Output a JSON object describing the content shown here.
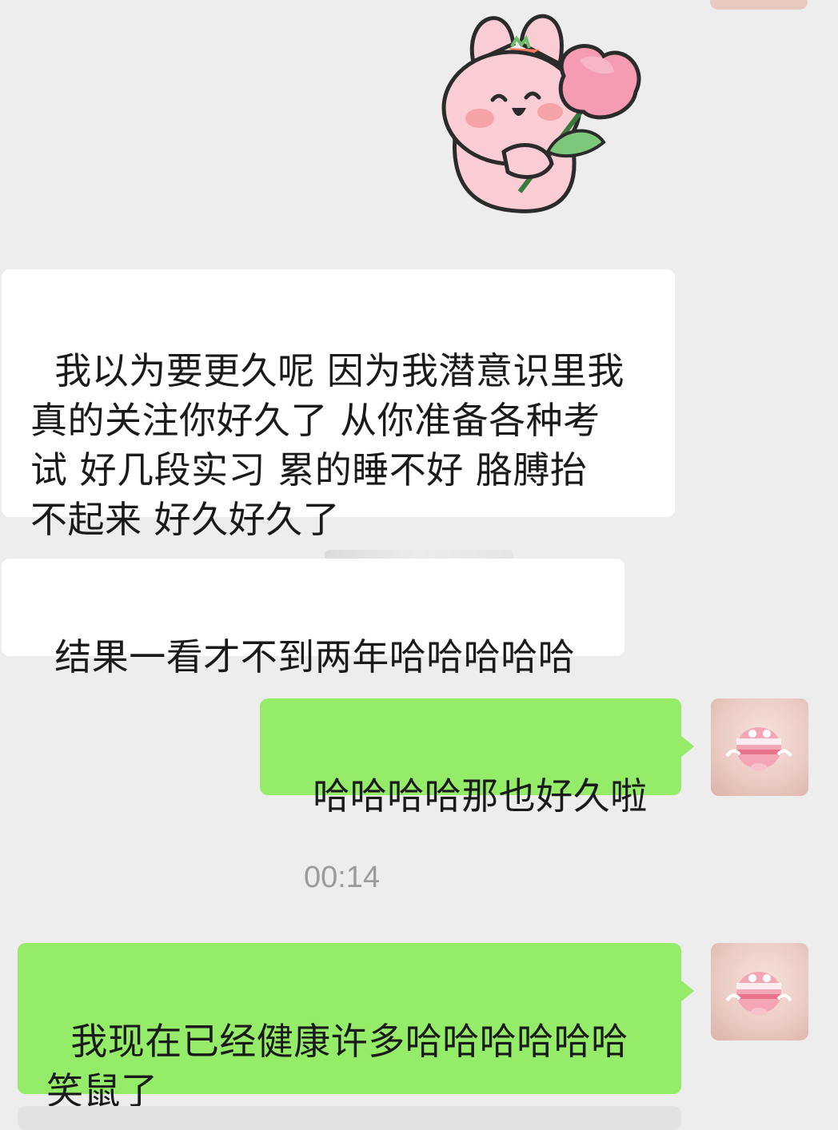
{
  "chat": {
    "messages": [
      {
        "side": "left",
        "type": "sticker",
        "sticker_name": "bunny-holding-pink-flower"
      },
      {
        "side": "left",
        "type": "text",
        "text": "我以为要更久呢 因为我潜意识里我\n真的关注你好久了 从你准备各种考\n试 好几段实习 累的睡不好 胳膊抬\n不起来 好久好久了"
      },
      {
        "side": "left",
        "type": "text",
        "text": "结果一看才不到两年哈哈哈哈哈"
      },
      {
        "side": "right",
        "type": "text",
        "text": "哈哈哈哈那也好久啦"
      },
      {
        "type": "timestamp",
        "text": "00:14"
      },
      {
        "side": "right",
        "type": "text",
        "text": "我现在已经健康许多哈哈哈哈哈哈\n笑鼠了"
      }
    ]
  },
  "colors": {
    "background": "#ededed",
    "left_bubble": "#ffffff",
    "right_bubble": "#95ec69",
    "timestamp_text": "#9b9b9b"
  },
  "icons": {
    "self_avatar": "pink-piggy-angel-avatar"
  }
}
